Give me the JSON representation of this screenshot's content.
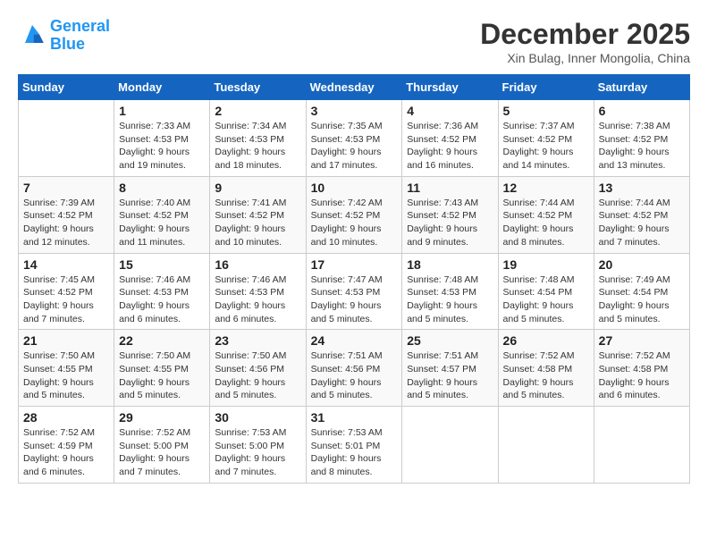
{
  "header": {
    "logo_line1": "General",
    "logo_line2": "Blue",
    "month": "December 2025",
    "location": "Xin Bulag, Inner Mongolia, China"
  },
  "weekdays": [
    "Sunday",
    "Monday",
    "Tuesday",
    "Wednesday",
    "Thursday",
    "Friday",
    "Saturday"
  ],
  "weeks": [
    [
      {
        "day": "",
        "sunrise": "",
        "sunset": "",
        "daylight": ""
      },
      {
        "day": "1",
        "sunrise": "Sunrise: 7:33 AM",
        "sunset": "Sunset: 4:53 PM",
        "daylight": "Daylight: 9 hours and 19 minutes."
      },
      {
        "day": "2",
        "sunrise": "Sunrise: 7:34 AM",
        "sunset": "Sunset: 4:53 PM",
        "daylight": "Daylight: 9 hours and 18 minutes."
      },
      {
        "day": "3",
        "sunrise": "Sunrise: 7:35 AM",
        "sunset": "Sunset: 4:53 PM",
        "daylight": "Daylight: 9 hours and 17 minutes."
      },
      {
        "day": "4",
        "sunrise": "Sunrise: 7:36 AM",
        "sunset": "Sunset: 4:52 PM",
        "daylight": "Daylight: 9 hours and 16 minutes."
      },
      {
        "day": "5",
        "sunrise": "Sunrise: 7:37 AM",
        "sunset": "Sunset: 4:52 PM",
        "daylight": "Daylight: 9 hours and 14 minutes."
      },
      {
        "day": "6",
        "sunrise": "Sunrise: 7:38 AM",
        "sunset": "Sunset: 4:52 PM",
        "daylight": "Daylight: 9 hours and 13 minutes."
      }
    ],
    [
      {
        "day": "7",
        "sunrise": "Sunrise: 7:39 AM",
        "sunset": "Sunset: 4:52 PM",
        "daylight": "Daylight: 9 hours and 12 minutes."
      },
      {
        "day": "8",
        "sunrise": "Sunrise: 7:40 AM",
        "sunset": "Sunset: 4:52 PM",
        "daylight": "Daylight: 9 hours and 11 minutes."
      },
      {
        "day": "9",
        "sunrise": "Sunrise: 7:41 AM",
        "sunset": "Sunset: 4:52 PM",
        "daylight": "Daylight: 9 hours and 10 minutes."
      },
      {
        "day": "10",
        "sunrise": "Sunrise: 7:42 AM",
        "sunset": "Sunset: 4:52 PM",
        "daylight": "Daylight: 9 hours and 10 minutes."
      },
      {
        "day": "11",
        "sunrise": "Sunrise: 7:43 AM",
        "sunset": "Sunset: 4:52 PM",
        "daylight": "Daylight: 9 hours and 9 minutes."
      },
      {
        "day": "12",
        "sunrise": "Sunrise: 7:44 AM",
        "sunset": "Sunset: 4:52 PM",
        "daylight": "Daylight: 9 hours and 8 minutes."
      },
      {
        "day": "13",
        "sunrise": "Sunrise: 7:44 AM",
        "sunset": "Sunset: 4:52 PM",
        "daylight": "Daylight: 9 hours and 7 minutes."
      }
    ],
    [
      {
        "day": "14",
        "sunrise": "Sunrise: 7:45 AM",
        "sunset": "Sunset: 4:52 PM",
        "daylight": "Daylight: 9 hours and 7 minutes."
      },
      {
        "day": "15",
        "sunrise": "Sunrise: 7:46 AM",
        "sunset": "Sunset: 4:53 PM",
        "daylight": "Daylight: 9 hours and 6 minutes."
      },
      {
        "day": "16",
        "sunrise": "Sunrise: 7:46 AM",
        "sunset": "Sunset: 4:53 PM",
        "daylight": "Daylight: 9 hours and 6 minutes."
      },
      {
        "day": "17",
        "sunrise": "Sunrise: 7:47 AM",
        "sunset": "Sunset: 4:53 PM",
        "daylight": "Daylight: 9 hours and 5 minutes."
      },
      {
        "day": "18",
        "sunrise": "Sunrise: 7:48 AM",
        "sunset": "Sunset: 4:53 PM",
        "daylight": "Daylight: 9 hours and 5 minutes."
      },
      {
        "day": "19",
        "sunrise": "Sunrise: 7:48 AM",
        "sunset": "Sunset: 4:54 PM",
        "daylight": "Daylight: 9 hours and 5 minutes."
      },
      {
        "day": "20",
        "sunrise": "Sunrise: 7:49 AM",
        "sunset": "Sunset: 4:54 PM",
        "daylight": "Daylight: 9 hours and 5 minutes."
      }
    ],
    [
      {
        "day": "21",
        "sunrise": "Sunrise: 7:50 AM",
        "sunset": "Sunset: 4:55 PM",
        "daylight": "Daylight: 9 hours and 5 minutes."
      },
      {
        "day": "22",
        "sunrise": "Sunrise: 7:50 AM",
        "sunset": "Sunset: 4:55 PM",
        "daylight": "Daylight: 9 hours and 5 minutes."
      },
      {
        "day": "23",
        "sunrise": "Sunrise: 7:50 AM",
        "sunset": "Sunset: 4:56 PM",
        "daylight": "Daylight: 9 hours and 5 minutes."
      },
      {
        "day": "24",
        "sunrise": "Sunrise: 7:51 AM",
        "sunset": "Sunset: 4:56 PM",
        "daylight": "Daylight: 9 hours and 5 minutes."
      },
      {
        "day": "25",
        "sunrise": "Sunrise: 7:51 AM",
        "sunset": "Sunset: 4:57 PM",
        "daylight": "Daylight: 9 hours and 5 minutes."
      },
      {
        "day": "26",
        "sunrise": "Sunrise: 7:52 AM",
        "sunset": "Sunset: 4:58 PM",
        "daylight": "Daylight: 9 hours and 5 minutes."
      },
      {
        "day": "27",
        "sunrise": "Sunrise: 7:52 AM",
        "sunset": "Sunset: 4:58 PM",
        "daylight": "Daylight: 9 hours and 6 minutes."
      }
    ],
    [
      {
        "day": "28",
        "sunrise": "Sunrise: 7:52 AM",
        "sunset": "Sunset: 4:59 PM",
        "daylight": "Daylight: 9 hours and 6 minutes."
      },
      {
        "day": "29",
        "sunrise": "Sunrise: 7:52 AM",
        "sunset": "Sunset: 5:00 PM",
        "daylight": "Daylight: 9 hours and 7 minutes."
      },
      {
        "day": "30",
        "sunrise": "Sunrise: 7:53 AM",
        "sunset": "Sunset: 5:00 PM",
        "daylight": "Daylight: 9 hours and 7 minutes."
      },
      {
        "day": "31",
        "sunrise": "Sunrise: 7:53 AM",
        "sunset": "Sunset: 5:01 PM",
        "daylight": "Daylight: 9 hours and 8 minutes."
      },
      {
        "day": "",
        "sunrise": "",
        "sunset": "",
        "daylight": ""
      },
      {
        "day": "",
        "sunrise": "",
        "sunset": "",
        "daylight": ""
      },
      {
        "day": "",
        "sunrise": "",
        "sunset": "",
        "daylight": ""
      }
    ]
  ]
}
